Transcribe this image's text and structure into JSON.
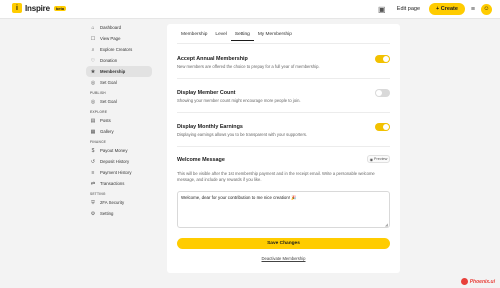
{
  "brand": {
    "name": "Inspire",
    "tag": "beta"
  },
  "header": {
    "edit_page_label": "Edit page",
    "create_label": "+ Create",
    "icons": [
      "gallery-icon",
      "menu-icon",
      "avatar"
    ]
  },
  "sidebar": {
    "items_main": [
      {
        "label": "Dashboard",
        "icon": "⌂"
      },
      {
        "label": "View Page",
        "icon": "☐"
      },
      {
        "label": "Explore Creators",
        "icon": "⌕"
      },
      {
        "label": "Donation",
        "icon": "♡"
      },
      {
        "label": "Membership",
        "icon": "★",
        "active": true
      },
      {
        "label": "Set Goal",
        "icon": "◎"
      }
    ],
    "section_publish": "PUBLISH",
    "items_publish": [
      {
        "label": "Set Goal",
        "icon": "◎"
      }
    ],
    "section_explore": "EXPLORE",
    "items_explore": [
      {
        "label": "Posts",
        "icon": "▤"
      },
      {
        "label": "Gallery",
        "icon": "▦"
      }
    ],
    "section_finance": "FINANCE",
    "items_finance": [
      {
        "label": "Payout Money",
        "icon": "$"
      },
      {
        "label": "Deposit History",
        "icon": "↺"
      },
      {
        "label": "Payment History",
        "icon": "≡"
      },
      {
        "label": "Transactions",
        "icon": "⇄"
      }
    ],
    "section_setting": "SETTING",
    "items_setting": [
      {
        "label": "2FA Security",
        "icon": "⛨"
      },
      {
        "label": "Setting",
        "icon": "⚙"
      }
    ]
  },
  "main": {
    "tabs": [
      {
        "label": "Membership"
      },
      {
        "label": "Level"
      },
      {
        "label": "Setting",
        "active": true
      },
      {
        "label": "My Membership"
      }
    ],
    "settings": [
      {
        "title": "Accept Annual Membership",
        "desc": "New members are offered the choice to prepay for a full year of membership.",
        "on": true
      },
      {
        "title": "Display Member Count",
        "desc": "Showing your member count might encourage more people to join.",
        "on": false
      },
      {
        "title": "Display Monthly Earnings",
        "desc": "Displaying earnings allows you to be transparent with your supporters.",
        "on": true
      }
    ],
    "welcome": {
      "title": "Welcome Message",
      "preview_label": "Preview",
      "desc": "This will be visible after the 1st membership payment and in the receipt email. Write a personable welcome message, and include any rewards if you like.",
      "value": "Welcome, dear for your contribution to me nice creation! 🎉"
    },
    "save_label": "Save Changes",
    "deactivate_label": "Deactivate Membership"
  },
  "watermark": "Phoenix.ui",
  "colors": {
    "accent": "#ffcc00",
    "toggle_on": "#f2c100",
    "watermark": "#e8403a"
  }
}
